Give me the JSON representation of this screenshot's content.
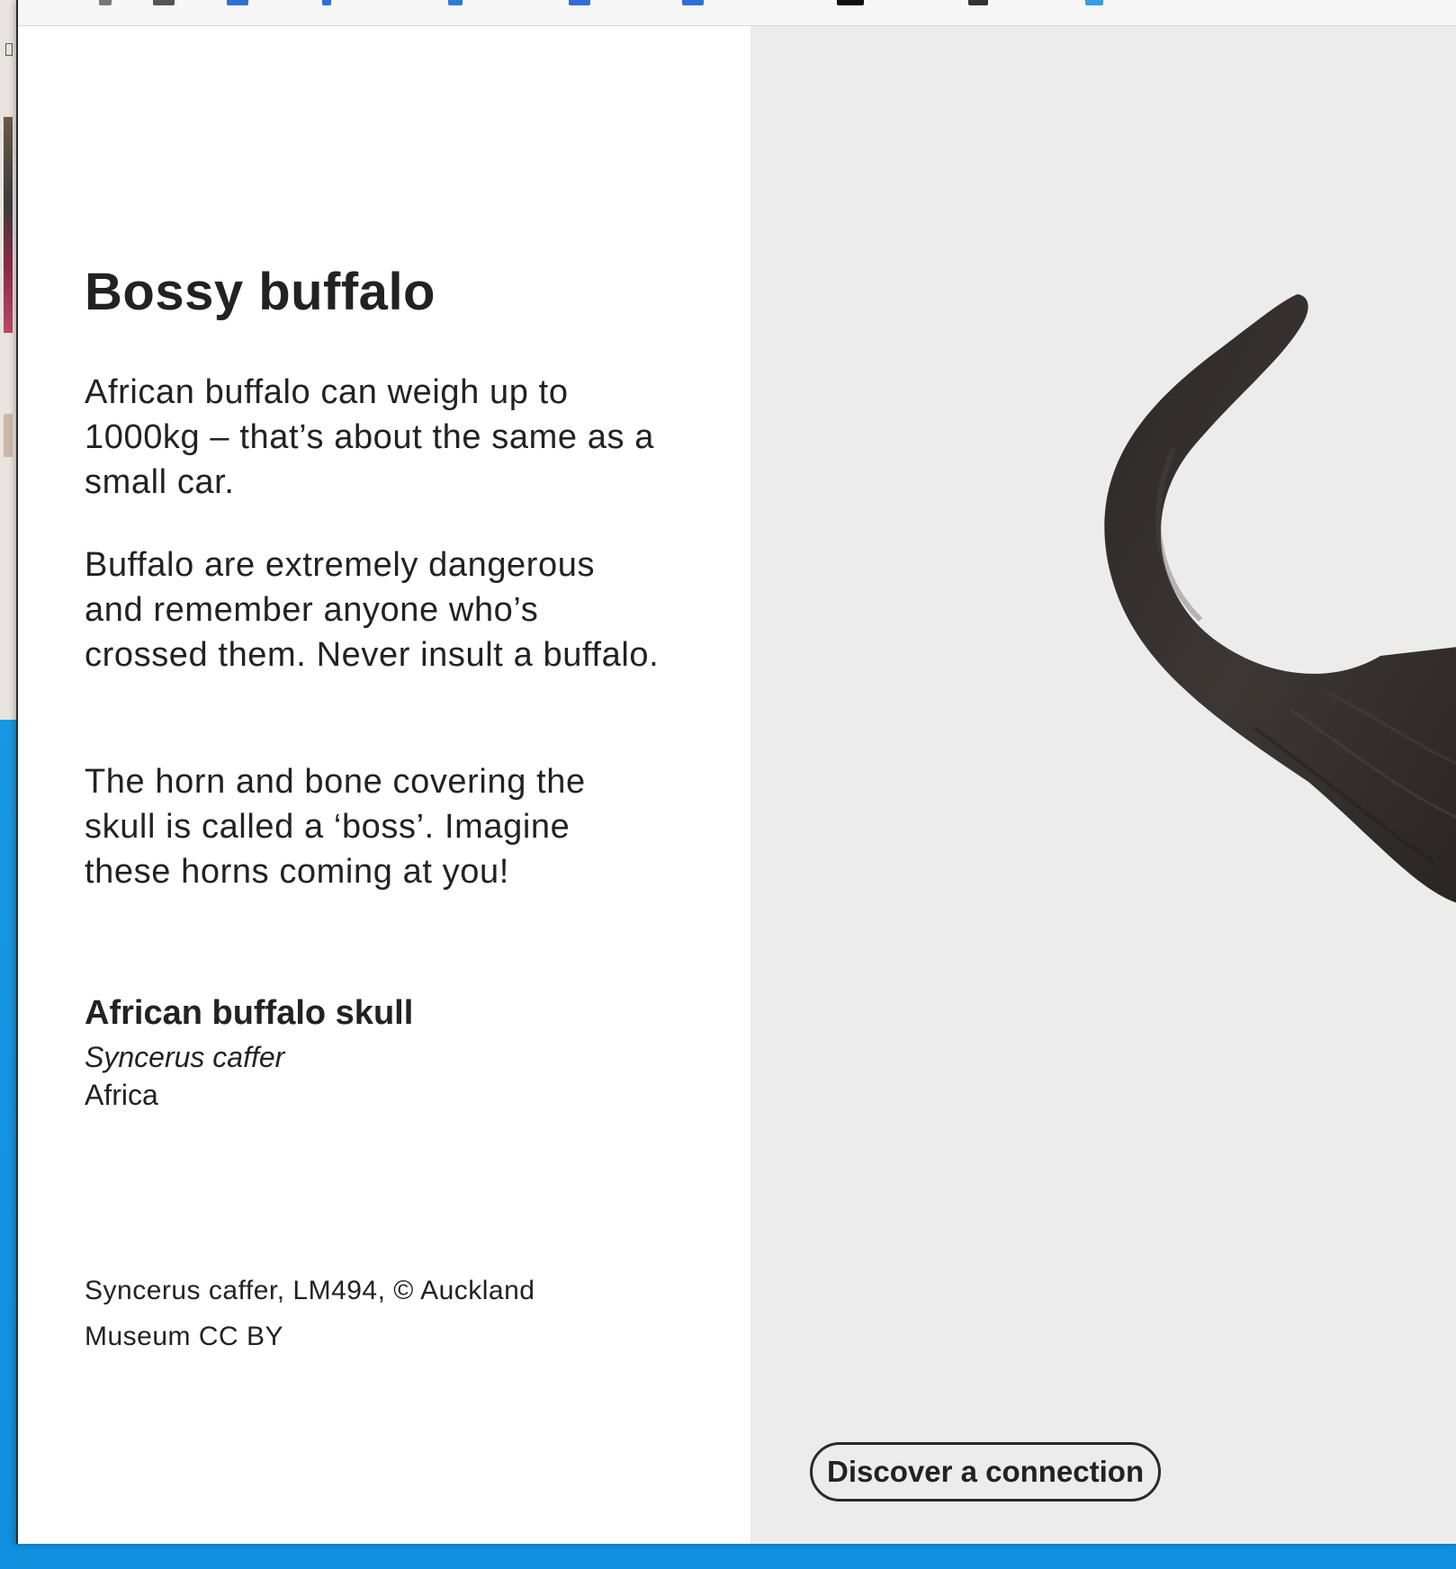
{
  "exhibit": {
    "title": "Bossy buffalo",
    "paragraphs": [
      "African buffalo can weigh up to 1000kg – that’s about the same as a small car.",
      "Buffalo are extremely dangerous and remember anyone who’s crossed them. Never insult a buffalo.",
      "The horn and bone covering the skull is called a ‘boss’. Imagine these horns coming at you!"
    ],
    "object": {
      "name": "African buffalo skull",
      "scientific_name": "Syncerus caffer",
      "origin": "Africa"
    },
    "credit": "Syncerus caffer, LM494, © Auckland Museum CC BY"
  },
  "actions": {
    "discover_label": "Discover a connection"
  },
  "image": {
    "subject": "buffalo-horn"
  },
  "colors": {
    "text": "#222222",
    "image_background": "#ececec",
    "desktop_background": "#1aa0e8",
    "horn": "#3a3532"
  }
}
